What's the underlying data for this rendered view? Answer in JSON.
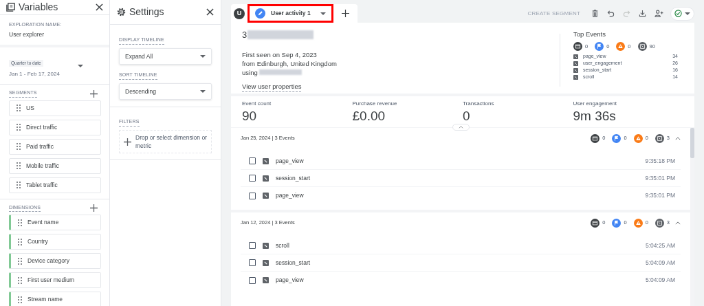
{
  "variables_panel": {
    "title": "Variables",
    "exploration_label": "EXPLORATION NAME:",
    "exploration_name": "User explorer",
    "date_range": {
      "label": "Quarter to date",
      "value": "Jan 1 - Feb 17, 2024"
    },
    "segments": {
      "title": "SEGMENTS",
      "items": [
        "US",
        "Direct traffic",
        "Paid traffic",
        "Mobile traffic",
        "Tablet traffic"
      ]
    },
    "dimensions": {
      "title": "DIMENSIONS",
      "items": [
        "Event name",
        "Country",
        "Device category",
        "First user medium",
        "Stream name"
      ]
    }
  },
  "settings_panel": {
    "title": "Settings",
    "display_timeline": {
      "label": "DISPLAY TIMELINE",
      "value": "Expand All"
    },
    "sort_timeline": {
      "label": "SORT TIMELINE",
      "value": "Descending"
    },
    "filters": {
      "label": "FILTERS",
      "placeholder": "Drop or select dimension or metric"
    }
  },
  "toolbar": {
    "user_initial": "U",
    "tabs": [
      {
        "label": "User activity 1",
        "selected": true,
        "highlighted": true
      }
    ],
    "create_segment": "CREATE SEGMENT",
    "redo_disabled": true
  },
  "user": {
    "id": "3",
    "first_seen": "First seen on Sep 4, 2023",
    "location": "from Edinburgh, United Kingdom",
    "using": "using",
    "view_properties": "View user properties"
  },
  "top_events": {
    "title": "Top Events",
    "counts": [
      {
        "kind": "conversion",
        "value": "0"
      },
      {
        "kind": "flag",
        "value": "0"
      },
      {
        "kind": "warning",
        "value": "0"
      },
      {
        "kind": "event",
        "value": "90"
      }
    ],
    "items": [
      {
        "name": "page_view",
        "count": "34"
      },
      {
        "name": "user_engagement",
        "count": "26"
      },
      {
        "name": "session_start",
        "count": "16"
      },
      {
        "name": "scroll",
        "count": "14"
      }
    ]
  },
  "metrics": [
    {
      "label": "Event count",
      "value": "90"
    },
    {
      "label": "Purchase revenue",
      "value": "£0.00"
    },
    {
      "label": "Transactions",
      "value": "0"
    },
    {
      "label": "User engagement",
      "value": "9m 36s"
    }
  ],
  "timeline": [
    {
      "date": "Jan 25, 2024 | 3 Events",
      "expanded": true,
      "counts": [
        {
          "kind": "conversion",
          "value": "0"
        },
        {
          "kind": "flag",
          "value": "0"
        },
        {
          "kind": "warning",
          "value": "0"
        },
        {
          "kind": "event",
          "value": "3"
        }
      ],
      "events": [
        {
          "name": "page_view",
          "time": "9:35:18 PM",
          "checked": false
        },
        {
          "name": "session_start",
          "time": "9:35:01 PM",
          "checked": false
        },
        {
          "name": "page_view",
          "time": "9:35:01 PM",
          "checked": false
        }
      ]
    },
    {
      "date": "Jan 12, 2024 | 3 Events",
      "expanded": true,
      "counts": [
        {
          "kind": "conversion",
          "value": "0"
        },
        {
          "kind": "flag",
          "value": "0"
        },
        {
          "kind": "warning",
          "value": "0"
        },
        {
          "kind": "event",
          "value": "3"
        }
      ],
      "events": [
        {
          "name": "scroll",
          "time": "5:04:25 AM",
          "checked": false
        },
        {
          "name": "session_start",
          "time": "5:04:09 AM",
          "checked": false
        },
        {
          "name": "page_view",
          "time": "5:04:09 AM",
          "checked": false
        }
      ]
    }
  ]
}
